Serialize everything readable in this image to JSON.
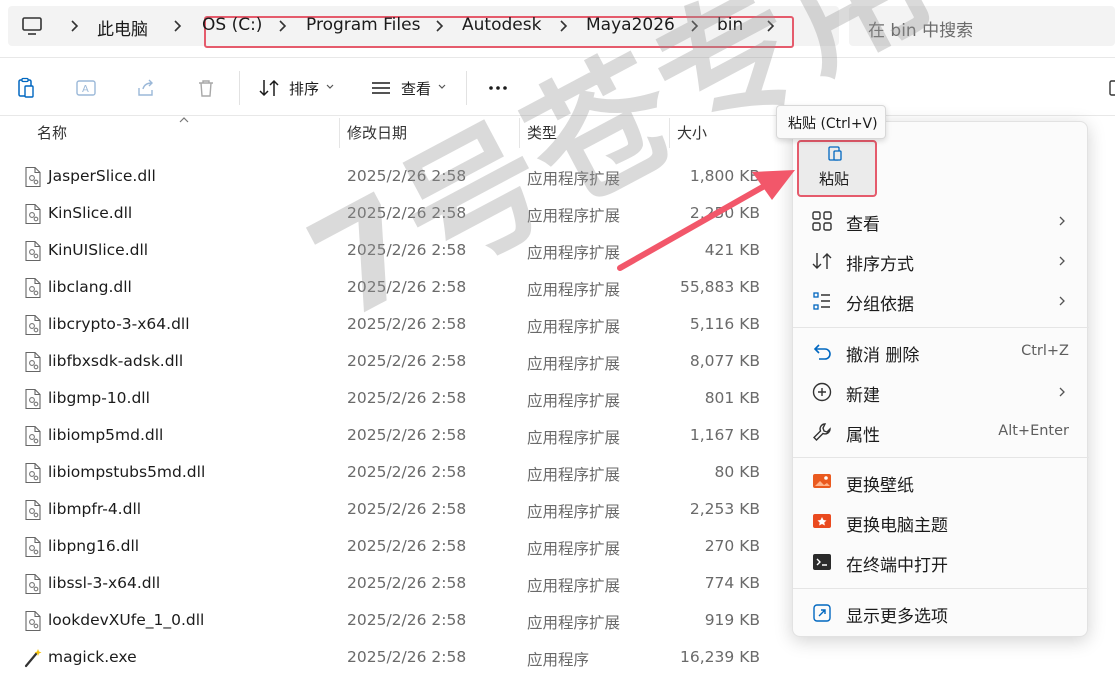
{
  "address": {
    "root_label": "此电脑",
    "crumbs": [
      "OS (C:)",
      "Program Files",
      "Autodesk",
      "Maya2026",
      "bin"
    ],
    "search_placeholder": "在 bin 中搜索"
  },
  "toolbar": {
    "sort_label": "排序",
    "view_label": "查看"
  },
  "columns": {
    "name": "名称",
    "date": "修改日期",
    "type": "类型",
    "size": "大小"
  },
  "files": [
    {
      "name": "JasperSlice.dll",
      "date": "2025/2/26 2:58",
      "type": "应用程序扩展",
      "size": "1,800 KB",
      "icon": "dll-file-icon"
    },
    {
      "name": "KinSlice.dll",
      "date": "2025/2/26 2:58",
      "type": "应用程序扩展",
      "size": "2,250 KB",
      "icon": "dll-file-icon"
    },
    {
      "name": "KinUISlice.dll",
      "date": "2025/2/26 2:58",
      "type": "应用程序扩展",
      "size": "421 KB",
      "icon": "dll-file-icon"
    },
    {
      "name": "libclang.dll",
      "date": "2025/2/26 2:58",
      "type": "应用程序扩展",
      "size": "55,883 KB",
      "icon": "dll-file-icon"
    },
    {
      "name": "libcrypto-3-x64.dll",
      "date": "2025/2/26 2:58",
      "type": "应用程序扩展",
      "size": "5,116 KB",
      "icon": "dll-file-icon"
    },
    {
      "name": "libfbxsdk-adsk.dll",
      "date": "2025/2/26 2:58",
      "type": "应用程序扩展",
      "size": "8,077 KB",
      "icon": "dll-file-icon"
    },
    {
      "name": "libgmp-10.dll",
      "date": "2025/2/26 2:58",
      "type": "应用程序扩展",
      "size": "801 KB",
      "icon": "dll-file-icon"
    },
    {
      "name": "libiomp5md.dll",
      "date": "2025/2/26 2:58",
      "type": "应用程序扩展",
      "size": "1,167 KB",
      "icon": "dll-file-icon"
    },
    {
      "name": "libiompstubs5md.dll",
      "date": "2025/2/26 2:58",
      "type": "应用程序扩展",
      "size": "80 KB",
      "icon": "dll-file-icon"
    },
    {
      "name": "libmpfr-4.dll",
      "date": "2025/2/26 2:58",
      "type": "应用程序扩展",
      "size": "2,253 KB",
      "icon": "dll-file-icon"
    },
    {
      "name": "libpng16.dll",
      "date": "2025/2/26 2:58",
      "type": "应用程序扩展",
      "size": "270 KB",
      "icon": "dll-file-icon"
    },
    {
      "name": "libssl-3-x64.dll",
      "date": "2025/2/26 2:58",
      "type": "应用程序扩展",
      "size": "774 KB",
      "icon": "dll-file-icon"
    },
    {
      "name": "lookdevXUfe_1_0.dll",
      "date": "2025/2/26 2:58",
      "type": "应用程序扩展",
      "size": "919 KB",
      "icon": "dll-file-icon"
    },
    {
      "name": "magick.exe",
      "date": "2025/2/26 2:58",
      "type": "应用程序",
      "size": "16,239 KB",
      "icon": "magic-wand-icon"
    }
  ],
  "context_menu": {
    "tooltip": "粘贴 (Ctrl+V)",
    "paste_label": "粘贴",
    "items": [
      {
        "label": "查看",
        "shortcut": "",
        "icon": "view-grid-icon",
        "submenu": true
      },
      {
        "label": "排序方式",
        "shortcut": "",
        "icon": "sort-icon",
        "submenu": true
      },
      {
        "label": "分组依据",
        "shortcut": "",
        "icon": "group-by-icon",
        "submenu": true
      },
      {
        "label": "撤消 删除",
        "shortcut": "Ctrl+Z",
        "icon": "undo-icon",
        "submenu": false
      },
      {
        "label": "新建",
        "shortcut": "",
        "icon": "new-plus-icon",
        "submenu": true
      },
      {
        "label": "属性",
        "shortcut": "Alt+Enter",
        "icon": "wrench-icon",
        "submenu": false
      },
      {
        "label": "更换壁纸",
        "shortcut": "",
        "icon": "wallpaper-icon",
        "submenu": false
      },
      {
        "label": "更换电脑主题",
        "shortcut": "",
        "icon": "theme-icon",
        "submenu": false
      },
      {
        "label": "在终端中打开",
        "shortcut": "",
        "icon": "terminal-icon",
        "submenu": false
      },
      {
        "label": "显示更多选项",
        "shortcut": "",
        "icon": "more-options-icon",
        "submenu": false
      }
    ]
  },
  "watermark": "7号苍专用",
  "colors": {
    "highlight": "#e55b6c",
    "accent": "#0067c0"
  }
}
